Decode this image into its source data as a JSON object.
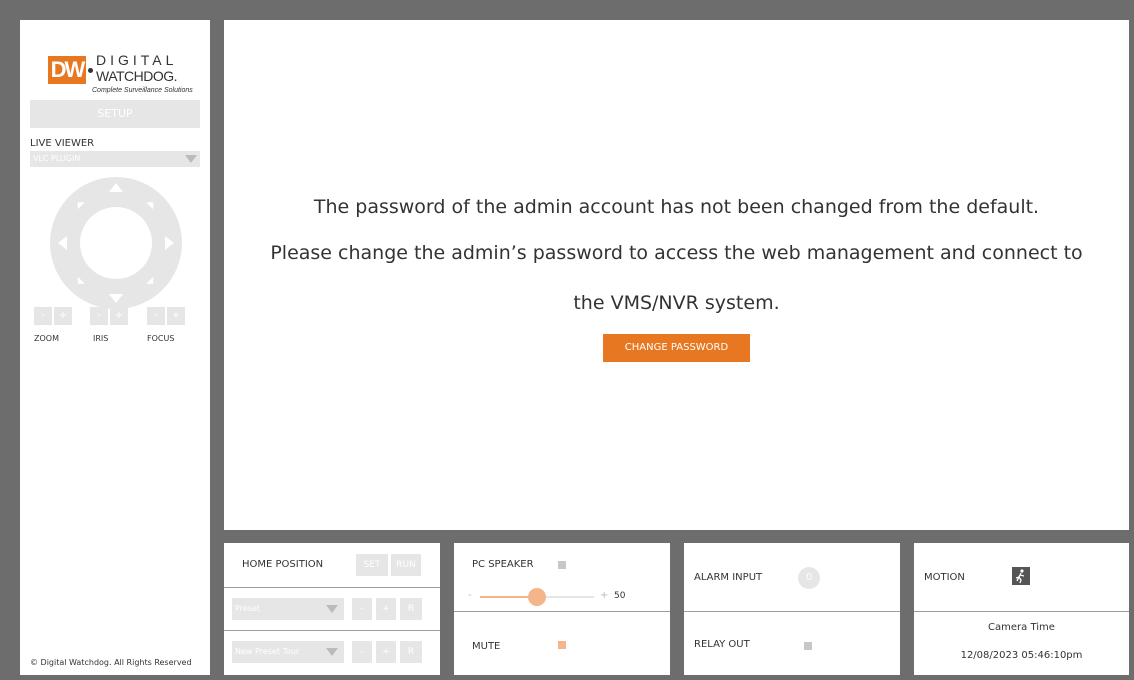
{
  "colors": {
    "accent": "#e87722",
    "disabled": "#e6e6e6",
    "frame": "#6d6d6d"
  },
  "logo": {
    "mark": "DW",
    "line1": "DIGITAL",
    "line2": "WATCHDOG.",
    "tagline": "Complete Surveillance Solutions"
  },
  "sidebar": {
    "setup_label": "SETUP",
    "live_viewer_label": "LIVE VIEWER",
    "plugin_select": "VLC PLUGIN",
    "lens_controls": [
      {
        "label": "ZOOM",
        "minus": "-",
        "plus": "+"
      },
      {
        "label": "IRIS",
        "minus": "-",
        "plus": "+"
      },
      {
        "label": "FOCUS",
        "minus": "-",
        "plus": "+"
      }
    ],
    "footer": "© Digital Watchdog. All Rights Reserved"
  },
  "main": {
    "message_lines": [
      "The password of the admin account has not been changed from the default.",
      "Please change the admin’s password to access the web management and connect to",
      "the VMS/NVR system."
    ],
    "change_password_label": "CHANGE PASSWORD"
  },
  "home_panel": {
    "home_position_label": "HOME POSITION",
    "set_label": "SET",
    "run_label": "RUN",
    "preset_select": "Preset",
    "preset_tour_select": "New Preset Tour",
    "minus": "-",
    "plus": "+",
    "r_label": "R"
  },
  "audio_panel": {
    "pc_speaker_label": "PC SPEAKER",
    "minus": "-",
    "plus": "+",
    "volume": 50,
    "volume_text": "50",
    "mute_label": "MUTE"
  },
  "alarm_panel": {
    "alarm_input_label": "ALARM INPUT",
    "alarm_count": "0",
    "relay_out_label": "RELAY OUT"
  },
  "status_panel": {
    "motion_label": "MOTION",
    "motion_icon": "running-person-icon",
    "camera_time_label": "Camera Time",
    "camera_time": "12/08/2023 05:46:10pm"
  }
}
